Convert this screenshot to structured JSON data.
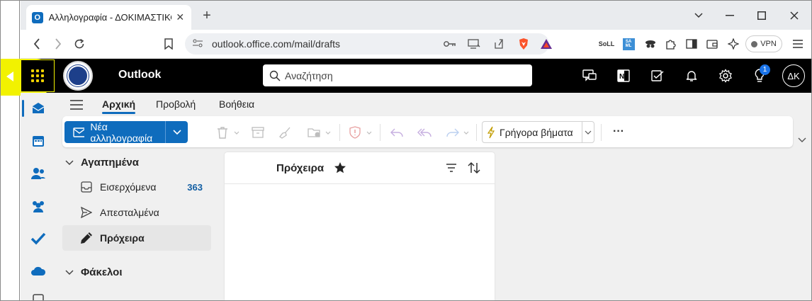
{
  "browser": {
    "tab_title": "Αλληλογραφία - ΔΟΚΙΜΑΣΤΙΚΟ",
    "tab_favicon": "O",
    "url": "outlook.office.com/mail/drafts",
    "vpn_label": "VPN",
    "ext_soll": "SoLL",
    "ext_saml": "SA ML"
  },
  "header": {
    "app_name": "Outlook",
    "search_placeholder": "Αναζήτηση",
    "tips_badge": "1",
    "avatar_initials": "ΔΚ"
  },
  "ribbon": {
    "tabs": [
      "Αρχική",
      "Προβολή",
      "Βοήθεια"
    ],
    "active_tab": "Αρχική",
    "new_mail_label": "Νέα αλληλογραφία",
    "quick_steps_label": "Γρήγορα βήματα",
    "more_label": "···"
  },
  "folders": {
    "favorites_header": "Αγαπημένα",
    "items": [
      {
        "label": "Εισερχόμενα",
        "count": "363"
      },
      {
        "label": "Απεσταλμένα",
        "count": ""
      },
      {
        "label": "Πρόχειρα",
        "count": ""
      }
    ],
    "folders_header": "Φάκελοι"
  },
  "message_list": {
    "title": "Πρόχειρα"
  },
  "colors": {
    "accent": "#0f6cbd",
    "highlight": "#f2f200",
    "header_bg": "#000000"
  }
}
